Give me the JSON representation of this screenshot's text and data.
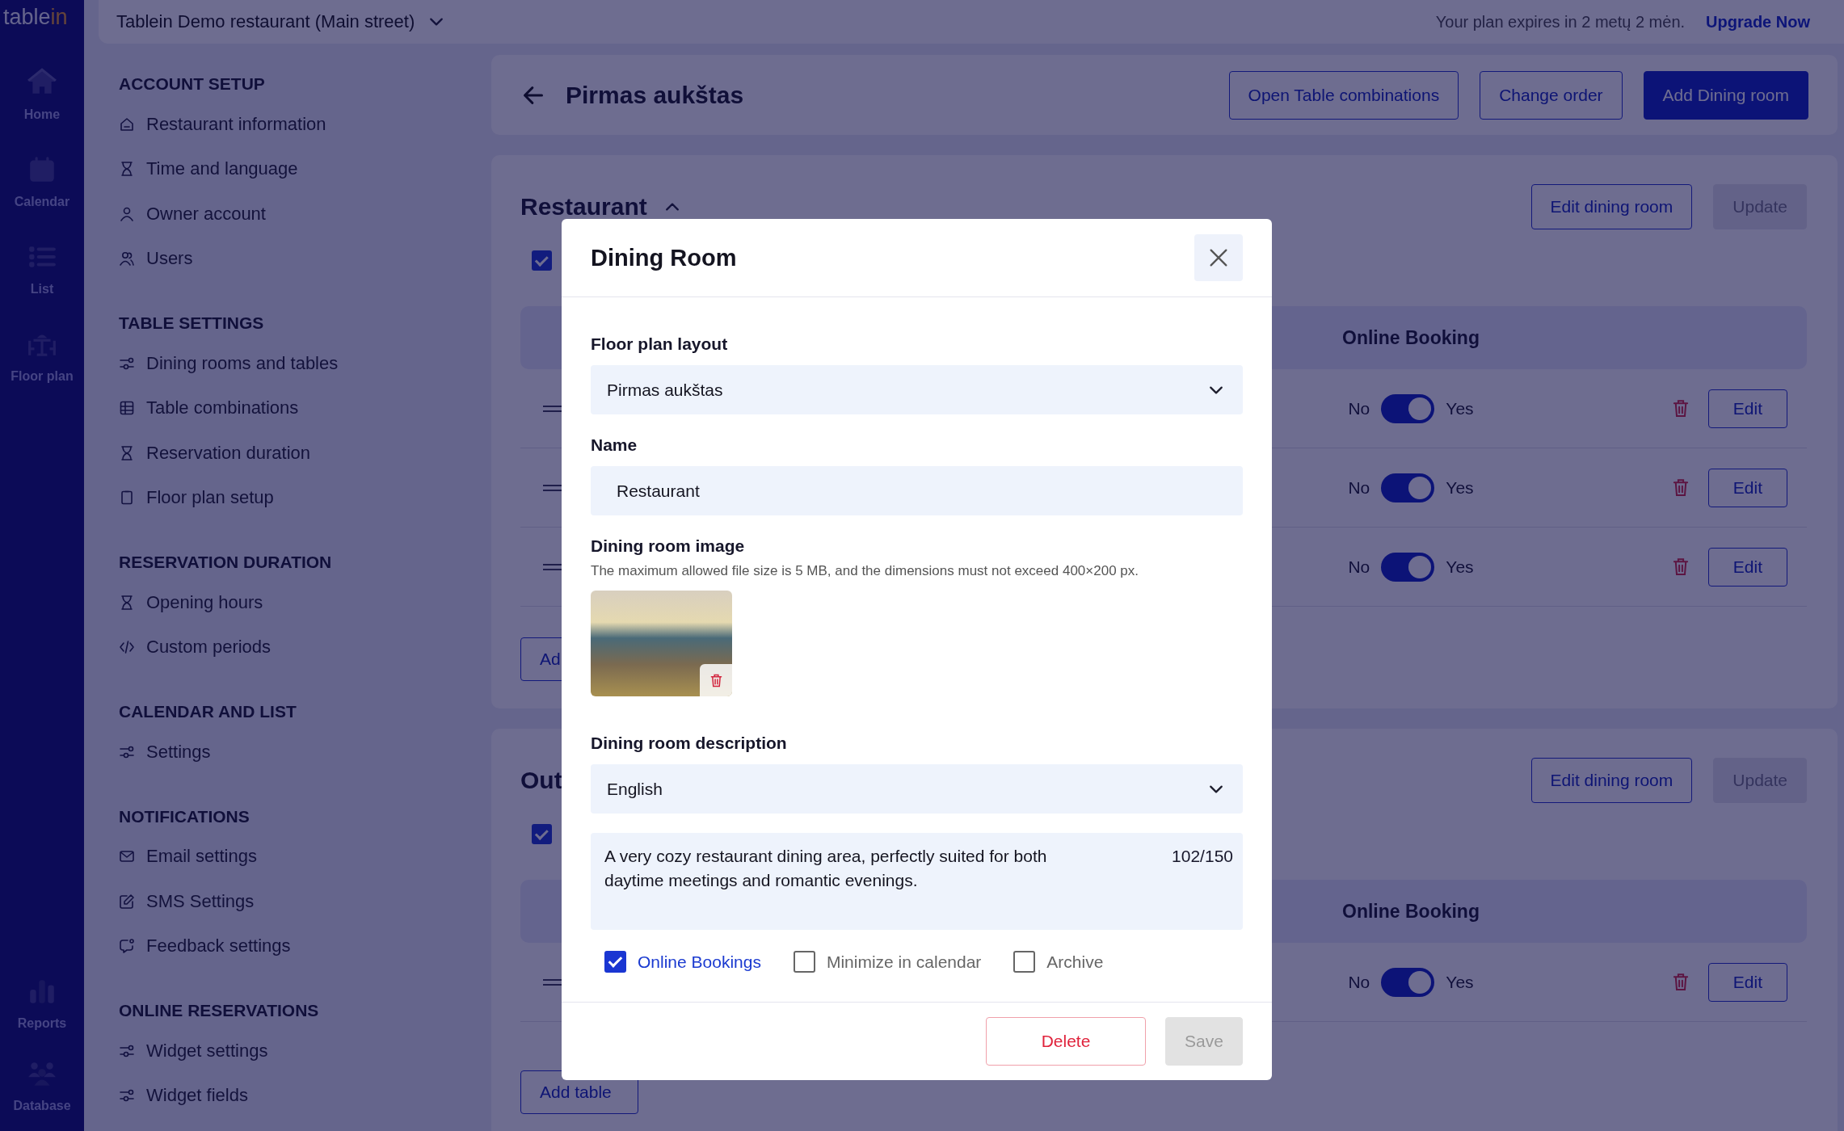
{
  "nav": {
    "logo": {
      "text": "table",
      "accent": "in"
    },
    "top_items": [
      {
        "label": "Home"
      },
      {
        "label": "Calendar"
      },
      {
        "label": "List"
      },
      {
        "label": "Floor plan"
      }
    ],
    "bottom_items": [
      {
        "label": "Reports"
      },
      {
        "label": "Database"
      }
    ]
  },
  "top_bar": {
    "restaurant": "Tablein Demo restaurant (Main street)",
    "plan_notice": "Your plan expires in 2 metų 2 mėn.",
    "upgrade_link": "Upgrade Now"
  },
  "sidebar": {
    "sections": [
      {
        "title": "ACCOUNT SETUP",
        "items": [
          {
            "label": "Restaurant information"
          },
          {
            "label": "Time and language"
          },
          {
            "label": "Owner account"
          },
          {
            "label": "Users"
          }
        ]
      },
      {
        "title": "TABLE SETTINGS",
        "items": [
          {
            "label": "Dining rooms and tables"
          },
          {
            "label": "Table combinations"
          },
          {
            "label": "Reservation duration"
          },
          {
            "label": "Floor plan setup"
          }
        ]
      },
      {
        "title": "RESERVATION DURATION",
        "items": [
          {
            "label": "Opening hours"
          },
          {
            "label": "Custom periods"
          }
        ]
      },
      {
        "title": "CALENDAR AND LIST",
        "items": [
          {
            "label": "Settings"
          }
        ]
      },
      {
        "title": "NOTIFICATIONS",
        "items": [
          {
            "label": "Email settings"
          },
          {
            "label": "SMS Settings"
          },
          {
            "label": "Feedback settings"
          }
        ]
      },
      {
        "title": "ONLINE RESERVATIONS",
        "items": [
          {
            "label": "Widget settings"
          },
          {
            "label": "Widget fields"
          }
        ]
      }
    ]
  },
  "header": {
    "title": "Pirmas aukštas",
    "buttons": [
      {
        "label": "Open Table combinations",
        "kind": "outline"
      },
      {
        "label": "Change order",
        "kind": "outline"
      },
      {
        "label": "Add Dining room",
        "kind": "primary"
      }
    ]
  },
  "sections": [
    {
      "title": "Restaurant",
      "expanded": true,
      "checked": true,
      "edit_button": "Edit dining room",
      "update_button": {
        "label": "Update",
        "disabled": true
      },
      "column_heading": "Online Booking",
      "add_button": "Ad",
      "rows": [
        {
          "no": "No",
          "yes": "Yes",
          "on": true,
          "edit": "Edit"
        },
        {
          "no": "No",
          "yes": "Yes",
          "on": true,
          "edit": "Edit"
        },
        {
          "no": "No",
          "yes": "Yes",
          "on": true,
          "edit": "Edit"
        }
      ]
    },
    {
      "title": "Out",
      "checked": true,
      "edit_button": "Edit dining room",
      "update_button": {
        "label": "Update",
        "disabled": true
      },
      "column_heading": "Online Booking",
      "add_button": "Add table",
      "rows": [
        {
          "no": "No",
          "yes": "Yes",
          "on": true,
          "edit": "Edit"
        }
      ]
    }
  ],
  "modal": {
    "title": "Dining Room",
    "floor_plan": {
      "label": "Floor plan layout",
      "value": "Pirmas aukštas"
    },
    "name": {
      "label": "Name",
      "value": "Restaurant"
    },
    "image": {
      "label": "Dining room image",
      "hint": "The maximum allowed file size is 5 MB, and the dimensions must not exceed 400×200 px."
    },
    "description": {
      "label": "Dining room description",
      "language": "English",
      "value": "A very cozy restaurant dining area, perfectly suited for both daytime meetings and romantic evenings.",
      "counter": "102/150"
    },
    "options": [
      {
        "label": "Online Bookings",
        "checked": true
      },
      {
        "label": "Minimize in calendar",
        "checked": false
      },
      {
        "label": "Archive",
        "checked": false
      }
    ],
    "delete_button": "Delete",
    "save_button": {
      "label": "Save",
      "disabled": true
    }
  }
}
